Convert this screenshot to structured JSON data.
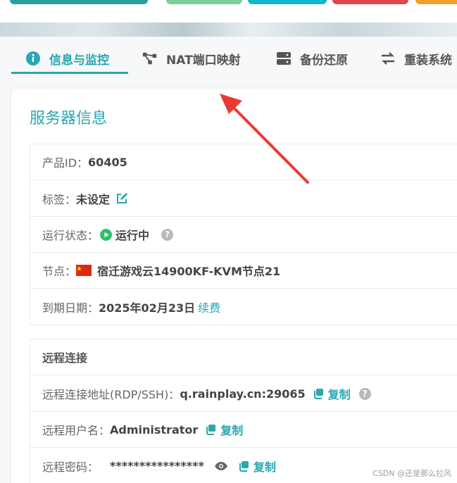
{
  "tabs": [
    {
      "label": "信息与监控",
      "icon": "info-icon",
      "active": true
    },
    {
      "label": "NAT端口映射",
      "icon": "nodes-icon",
      "active": false
    },
    {
      "label": "备份还原",
      "icon": "server-icon",
      "active": false
    },
    {
      "label": "重装系统",
      "icon": "swap-arrows-icon",
      "active": false
    }
  ],
  "card": {
    "title": "服务器信息",
    "rows": {
      "product_id": {
        "label": "产品ID：",
        "value": "60405"
      },
      "tag": {
        "label": "标签：",
        "value": "未设定"
      },
      "status": {
        "label": "运行状态：",
        "value": "运行中",
        "help": "?"
      },
      "node": {
        "label": "节点：",
        "value": "宿迁游戏云14900KF-KVM节点21"
      },
      "expiry": {
        "label": "到期日期：",
        "value": "2025年02月23日",
        "link": "续费"
      }
    }
  },
  "remote": {
    "title": "远程连接",
    "address": {
      "label": "远程连接地址(RDP/SSH)：",
      "value": "q.rainplay.cn:29065",
      "copy": "复制",
      "help": "?"
    },
    "username": {
      "label": "远程用户名：",
      "value": "Administrator",
      "copy": "复制"
    },
    "password": {
      "label": "远程密码：",
      "value": "****************",
      "copy": "复制"
    }
  },
  "watermark": "CSDN @还是那么拉风",
  "colors": {
    "accent": "#2aa7b0",
    "status_green": "#2ebf6e",
    "arrow_red": "#ea3b32"
  }
}
